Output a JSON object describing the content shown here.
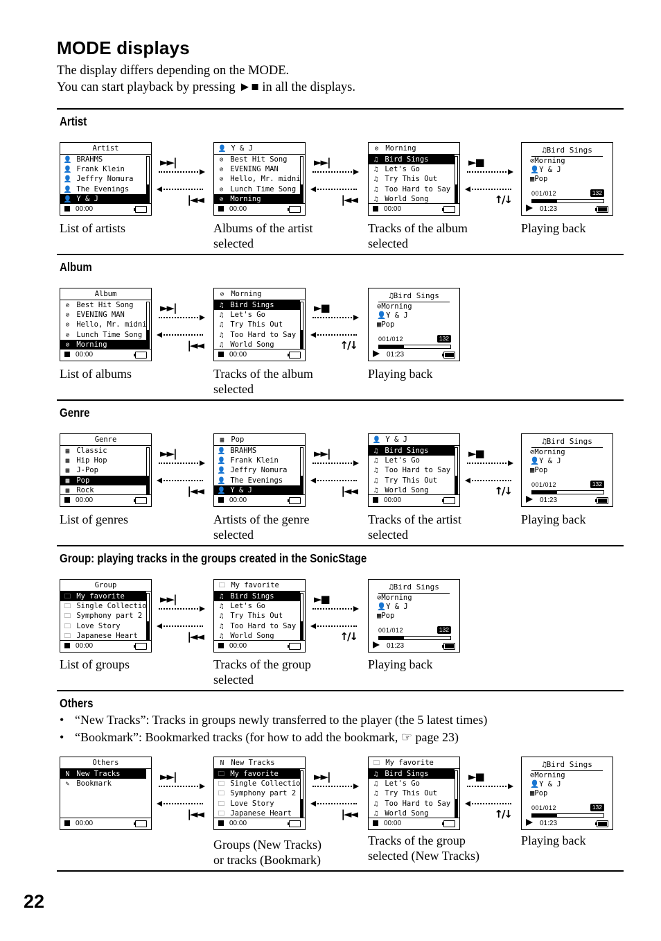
{
  "page": {
    "title": "MODE displays",
    "intro": [
      "The display differs depending on the MODE.",
      "You can start playback by pressing ►■ in all the displays."
    ],
    "page_number": "22"
  },
  "icons": {
    "artist": "👤",
    "album": "⊘",
    "track": "♫",
    "genre": "▦",
    "group": "🗀",
    "new": "N",
    "bookmark": "✎"
  },
  "symbols": {
    "next": "►►|",
    "prev": "|◄◄",
    "play_stop": "►■",
    "up_down": "↑/↓"
  },
  "playback": {
    "title": "Bird Sings",
    "album": "Morning",
    "artist": "Y & J",
    "genre": "Pop",
    "counter": "001/012",
    "bitrate": "132",
    "time": "01:23",
    "progress_fraction": 0.35
  },
  "stopped_time": "00:00",
  "sections": [
    {
      "title": "Artist",
      "screens": [
        {
          "header": "Artist",
          "header_align": "center",
          "items": [
            {
              "icon": "artist",
              "text": "BRAHMS"
            },
            {
              "icon": "artist",
              "text": "Frank Klein"
            },
            {
              "icon": "artist",
              "text": "Jeffry Nomura"
            },
            {
              "icon": "artist",
              "text": "The Evenings"
            },
            {
              "icon": "artist",
              "text": "Y & J",
              "selected": true
            }
          ],
          "caption": "List of artists"
        },
        {
          "header": "Y & J",
          "header_icon": "artist",
          "items": [
            {
              "icon": "album",
              "text": "Best Hit Song"
            },
            {
              "icon": "album",
              "text": "EVENING MAN"
            },
            {
              "icon": "album",
              "text": "Hello, Mr. midni"
            },
            {
              "icon": "album",
              "text": "Lunch Time Song"
            },
            {
              "icon": "album",
              "text": "Morning",
              "selected": true
            }
          ],
          "caption": "Albums of the artist\nselected"
        },
        {
          "header": "Morning",
          "header_icon": "album",
          "items": [
            {
              "icon": "track",
              "text": "Bird Sings",
              "selected": true
            },
            {
              "icon": "track",
              "text": "Let's Go"
            },
            {
              "icon": "track",
              "text": "Try This Out"
            },
            {
              "icon": "track",
              "text": "Too Hard to Say"
            },
            {
              "icon": "track",
              "text": "World Song"
            }
          ],
          "caption": "Tracks of the album\nselected"
        },
        {
          "playback": true,
          "caption": "Playing back"
        }
      ]
    },
    {
      "title": "Album",
      "screens": [
        {
          "header": "Album",
          "header_align": "center",
          "items": [
            {
              "icon": "album",
              "text": "Best Hit Song"
            },
            {
              "icon": "album",
              "text": "EVENING MAN"
            },
            {
              "icon": "album",
              "text": "Hello, Mr. midni"
            },
            {
              "icon": "album",
              "text": "Lunch Time Song"
            },
            {
              "icon": "album",
              "text": "Morning",
              "selected": true
            }
          ],
          "caption": "List of albums"
        },
        {
          "header": "Morning",
          "header_icon": "album",
          "items": [
            {
              "icon": "track",
              "text": "Bird Sings",
              "selected": true
            },
            {
              "icon": "track",
              "text": "Let's Go"
            },
            {
              "icon": "track",
              "text": "Try This Out"
            },
            {
              "icon": "track",
              "text": "Too Hard to Say"
            },
            {
              "icon": "track",
              "text": "World Song"
            }
          ],
          "caption": "Tracks of the album\nselected"
        },
        {
          "playback": true,
          "caption": "Playing back"
        }
      ]
    },
    {
      "title": "Genre",
      "screens": [
        {
          "header": "Genre",
          "header_align": "center",
          "items": [
            {
              "icon": "genre",
              "text": "Classic"
            },
            {
              "icon": "genre",
              "text": "Hip Hop"
            },
            {
              "icon": "genre",
              "text": "J-Pop"
            },
            {
              "icon": "genre",
              "text": "Pop",
              "selected": true
            },
            {
              "icon": "genre",
              "text": "Rock"
            }
          ],
          "caption": "List of genres"
        },
        {
          "header": "Pop",
          "header_icon": "genre",
          "items": [
            {
              "icon": "artist",
              "text": "BRAHMS"
            },
            {
              "icon": "artist",
              "text": "Frank Klein"
            },
            {
              "icon": "artist",
              "text": "Jeffry Nomura"
            },
            {
              "icon": "artist",
              "text": "The Evenings"
            },
            {
              "icon": "artist",
              "text": "Y & J",
              "selected": true
            }
          ],
          "caption": "Artists of the genre\nselected"
        },
        {
          "header": "Y & J",
          "header_icon": "artist",
          "items": [
            {
              "icon": "track",
              "text": "Bird Sings",
              "selected": true
            },
            {
              "icon": "track",
              "text": "Let's Go"
            },
            {
              "icon": "track",
              "text": "Too Hard to Say"
            },
            {
              "icon": "track",
              "text": "Try This Out"
            },
            {
              "icon": "track",
              "text": "World Song"
            }
          ],
          "caption": "Tracks of the artist\nselected"
        },
        {
          "playback": true,
          "caption": "Playing back"
        }
      ]
    },
    {
      "title": "Group: playing tracks in the groups created in the SonicStage",
      "screens": [
        {
          "header": "Group",
          "header_align": "center",
          "items": [
            {
              "icon": "group",
              "text": "My favorite",
              "selected": true
            },
            {
              "icon": "group",
              "text": "Single Collectio"
            },
            {
              "icon": "group",
              "text": "Symphony part 2"
            },
            {
              "icon": "group",
              "text": "Love Story"
            },
            {
              "icon": "group",
              "text": "Japanese Heart"
            }
          ],
          "caption": "List of groups"
        },
        {
          "header": "My favorite",
          "header_icon": "group",
          "items": [
            {
              "icon": "track",
              "text": "Bird Sings",
              "selected": true
            },
            {
              "icon": "track",
              "text": "Let's Go"
            },
            {
              "icon": "track",
              "text": "Try This Out"
            },
            {
              "icon": "track",
              "text": "Too Hard to Say"
            },
            {
              "icon": "track",
              "text": "World Song"
            }
          ],
          "caption": "Tracks of the group\nselected"
        },
        {
          "playback": true,
          "caption": "Playing back"
        }
      ]
    },
    {
      "title": "Others",
      "bullets": [
        "“New Tracks”: Tracks in groups newly transferred to the player (the 5 latest times)",
        "“Bookmark”: Bookmarked tracks (for how to add the bookmark, ☞ page 23)"
      ],
      "screens": [
        {
          "header": "Others",
          "header_align": "center",
          "no_scrollbar": true,
          "items": [
            {
              "icon": "new",
              "text": "New Tracks",
              "selected": true
            },
            {
              "icon": "bookmark",
              "text": "Bookmark"
            }
          ],
          "caption": ""
        },
        {
          "header": "New Tracks",
          "header_icon": "new",
          "items": [
            {
              "icon": "group",
              "text": "My favorite",
              "selected": true
            },
            {
              "icon": "group",
              "text": "Single Collectio"
            },
            {
              "icon": "group",
              "text": "Symphony part 2"
            },
            {
              "icon": "group",
              "text": "Love Story"
            },
            {
              "icon": "group",
              "text": "Japanese Heart"
            }
          ],
          "caption": "Groups (New Tracks)\nor tracks (Bookmark)"
        },
        {
          "header": "My favorite",
          "header_icon": "group",
          "items": [
            {
              "icon": "track",
              "text": "Bird Sings",
              "selected": true
            },
            {
              "icon": "track",
              "text": "Let's Go"
            },
            {
              "icon": "track",
              "text": "Try This Out"
            },
            {
              "icon": "track",
              "text": "Too Hard to Say"
            },
            {
              "icon": "track",
              "text": "World Song"
            }
          ],
          "caption": "Tracks of the group\nselected (New Tracks)"
        },
        {
          "playback": true,
          "caption": "Playing back"
        }
      ]
    }
  ]
}
